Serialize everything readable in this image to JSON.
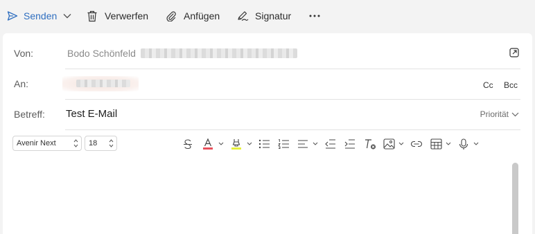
{
  "toolbar": {
    "send_label": "Senden",
    "discard_label": "Verwerfen",
    "attach_label": "Anfügen",
    "signature_label": "Signatur"
  },
  "compose": {
    "from_label": "Von:",
    "from_name": "Bodo Schönfeld",
    "to_label": "An:",
    "cc_label": "Cc",
    "bcc_label": "Bcc",
    "subject_label": "Betreff:",
    "subject_value": "Test E-Mail",
    "priority_label": "Priorität"
  },
  "format": {
    "font_family": "Avenir Next",
    "font_size": "18"
  },
  "colors": {
    "accent": "#2f6fc0",
    "font_color_bar": "#e8505b",
    "highlight_bar": "#e6f03c"
  }
}
